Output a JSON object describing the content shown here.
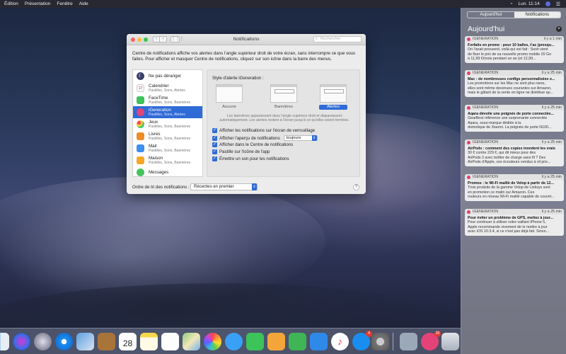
{
  "menubar": {
    "items": [
      "Édition",
      "Présentation",
      "Fenêtre",
      "Aide"
    ],
    "clock": "Lun. 11:14"
  },
  "nc": {
    "tabs": [
      "Aujourd'hui",
      "Notifications"
    ],
    "title": "Aujourd'hui",
    "close": "×",
    "notifications": [
      {
        "app": "IGENERATION",
        "time": "il y a 1 min",
        "title": "Forfaits en promo : pour 10 balles, t'as (presqu...",
        "body": [
          "On l'avait pressenti, voilà qui est fait : Sosh vient",
          "de fixer le prix de sa nouvelle promo mobile 20 Go",
          "à 11,99 €/mois pendant un an (et 12,99..."
        ]
      },
      {
        "app": "IGENERATION",
        "time": "il y a 25 min",
        "title": "Mac : de nombreuses configs personnalisées e...",
        "body": [
          "Les promotions sur les Mac ne sont plus rares,",
          "elles sont même devenues courantes sur Amazon,",
          "mais le gâtant de la vente en ligne ne distribue qu..."
        ]
      },
      {
        "app": "IGENERATION",
        "time": "il y a 25 min",
        "title": "Aqara dévoile une poignée de porte connectée...",
        "body": [
          "GearBest référence une surprenante connectée",
          "Aqara, sous-marque dédiée à la",
          "domotique de Xiaomi. La poignée de porte N100..."
        ]
      },
      {
        "app": "IGENERATION",
        "time": "il y a 25 min",
        "title": "AirPods : comment des copies inondent les vrais",
        "body": [
          "30 € contre 229 €, qui dit mieux pour des",
          "AirPods 2 avec boîtier de charge sans fil ? Des",
          "AirPods d'Apple, ces écouteurs vendus à vil prix..."
        ]
      },
      {
        "app": "IGENERATION",
        "time": "il y a 25 min",
        "title": "Promos : le Wi-Fi maillé de Velop à partir de 12...",
        "body": [
          "Trois produits de la gamme Velop de Linksys sont",
          "en promotion ce matin sur Amazon. Ces",
          "routeurs en réseau Wi-Fi maillé capable de couvrir..."
        ]
      },
      {
        "app": "IGENERATION",
        "time": "il y a 25 min",
        "title": "Pour éviter un problème de GPS, mettez à jour...",
        "body": [
          "Pour continuer à utiliser votre vaillant iPhone 5,",
          "Apple recommande vivement de le mettre à jour",
          "avec iOS 10.3.4, si ce n'est pas déjà fait. Sinon..."
        ]
      }
    ]
  },
  "window": {
    "title": "Notifications",
    "search_placeholder": "Rechercher",
    "intro": "Centre de notifications affiche vos alertes dans l'angle supérieur droit de votre écran, sans interrompre ce que vous faites. Pour afficher et masquer Centre de notifications, cliquez sur son icône dans la barre des menus.",
    "apps": [
      {
        "name": "Ne pas déranger",
        "sub": "",
        "color": "#3a3f6a"
      },
      {
        "name": "Calendrier",
        "sub": "Pastilles, Sons, Alertes",
        "color": "#f2f2f2"
      },
      {
        "name": "FaceTime",
        "sub": "Pastilles, Sons, Bannières",
        "color": "#3cc35a"
      },
      {
        "name": "iGeneration",
        "sub": "Pastilles, Sons, Alertes",
        "color": "#e44378"
      },
      {
        "name": "Jeux",
        "sub": "Pastilles, Sons, Bannières",
        "color": "#f2a03c"
      },
      {
        "name": "Livres",
        "sub": "Pastilles, Sons, Bannières",
        "color": "#f08a24"
      },
      {
        "name": "Mail",
        "sub": "Pastilles, Sons, Bannières",
        "color": "#3d8ff0"
      },
      {
        "name": "Maison",
        "sub": "Pastilles, Sons, Bannières",
        "color": "#f6a623"
      },
      {
        "name": "Messages",
        "sub": "",
        "color": "#45c35d"
      }
    ],
    "selected_app": "iGeneration",
    "style_label": "Style d'alerte iGeneration :",
    "styles": [
      "Aucune",
      "Bannières",
      "Alertes"
    ],
    "active_style": "Alertes",
    "style_note": "Les bannières apparaissent dans l'angle supérieur droit et disparaissent automatiquement. Les alertes restent à l'écran jusqu'à ce qu'elles soient fermées.",
    "options": [
      "Afficher les notifications sur l'écran de verrouillage",
      "Afficher l'aperçu de notifications",
      "Afficher dans le Centre de notifications",
      "Pastille sur l'icône de l'app",
      "Émettre un son pour les notifications"
    ],
    "preview_value": "toujours",
    "sort_label": "Ordre de tri des notifications :",
    "sort_value": "Récentes en premier",
    "help": "?"
  },
  "dock": {
    "calendar_day": "28",
    "badges": {
      "app_store": "4",
      "igeneration": "20"
    }
  },
  "colors": {
    "accent": "#2f6bd6",
    "brand": "#e44378"
  }
}
